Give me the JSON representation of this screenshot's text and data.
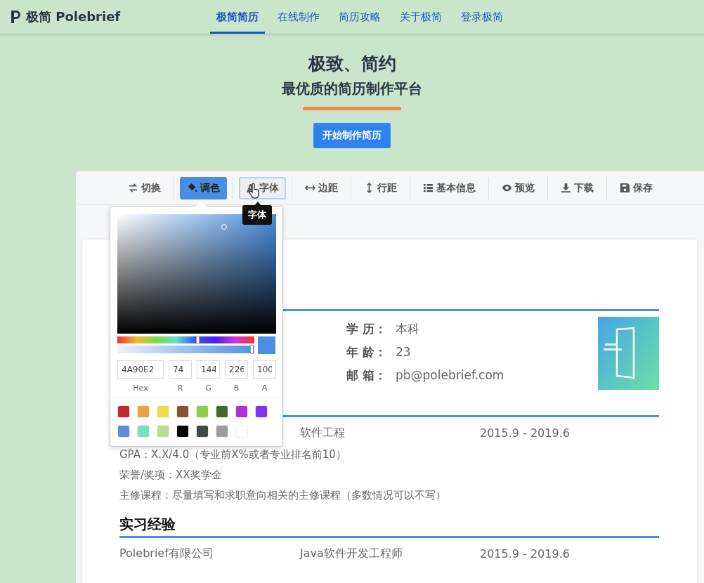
{
  "nav": {
    "brand": "极简 Polebrief",
    "items": [
      {
        "label": "极简简历",
        "selected": true
      },
      {
        "label": "在线制作",
        "selected": false
      },
      {
        "label": "简历攻略",
        "selected": false
      },
      {
        "label": "关于极简",
        "selected": false
      },
      {
        "label": "登录极简",
        "selected": false
      }
    ]
  },
  "hero": {
    "title": "极致、简约",
    "subtitle": "最优质的简历制作平台",
    "button": "开始制作简历"
  },
  "toolbar": {
    "buttons": [
      {
        "label": "切换",
        "selected": false,
        "hovered": false
      },
      {
        "label": "调色",
        "selected": true,
        "hovered": false
      },
      {
        "label": "字体",
        "selected": false,
        "hovered": true
      },
      {
        "label": "边距",
        "selected": false,
        "hovered": false
      },
      {
        "label": "行距",
        "selected": false,
        "hovered": false
      },
      {
        "label": "基本信息",
        "selected": false,
        "hovered": false
      },
      {
        "label": "预览",
        "selected": false,
        "hovered": false
      },
      {
        "label": "下载",
        "selected": false,
        "hovered": false
      },
      {
        "label": "保存",
        "selected": false,
        "hovered": false
      }
    ],
    "tooltip": "字体"
  },
  "color_picker": {
    "color": "#4a90e2",
    "hue_slider": {
      "level": 0.59
    },
    "alpha_slider": {
      "level": 1
    },
    "fields": [
      {
        "label": "Hex",
        "value": "4A90E2"
      },
      {
        "label": "R",
        "value": "74"
      },
      {
        "label": "G",
        "value": "144"
      },
      {
        "label": "B",
        "value": "226"
      },
      {
        "label": "A",
        "value": "100"
      }
    ],
    "swatches": [
      {
        "color": "#c4272b"
      },
      {
        "color": "#eba53f"
      },
      {
        "color": "#f0dc4a"
      },
      {
        "color": "#8a5235"
      },
      {
        "color": "#8fcc48"
      },
      {
        "color": "#3f6b2c"
      },
      {
        "color": "#b02fdc"
      },
      {
        "color": "#8331f0"
      },
      {
        "color": "#5a8fdf"
      },
      {
        "color": "#7adfc0"
      },
      {
        "color": "#bcdb99"
      },
      {
        "color": "#000000"
      },
      {
        "color": "#434a49"
      },
      {
        "color": "#9d9d9d"
      },
      {
        "color": "#ffffff"
      }
    ]
  },
  "resume": {
    "info": [
      {
        "label": "学 历：",
        "value": "本科"
      },
      {
        "label": "年 龄：",
        "value": "23"
      },
      {
        "label": "邮 箱：",
        "value": "pb@polebrief.com"
      }
    ],
    "education": {
      "major": "软件工程",
      "period": "2015.9 - 2019.6",
      "lines": [
        "GPA：X.X/4.0（专业前X%或者专业排名前10）",
        "荣誉/奖项：XX奖学金",
        "主修课程：尽量填写和求职意向相关的主修课程（多数情况可以不写）"
      ]
    },
    "internship": {
      "heading": "实习经验",
      "company": "Polebrief有限公司",
      "role": "Java软件开发工程师",
      "period": "2015.9 - 2019.6"
    }
  }
}
